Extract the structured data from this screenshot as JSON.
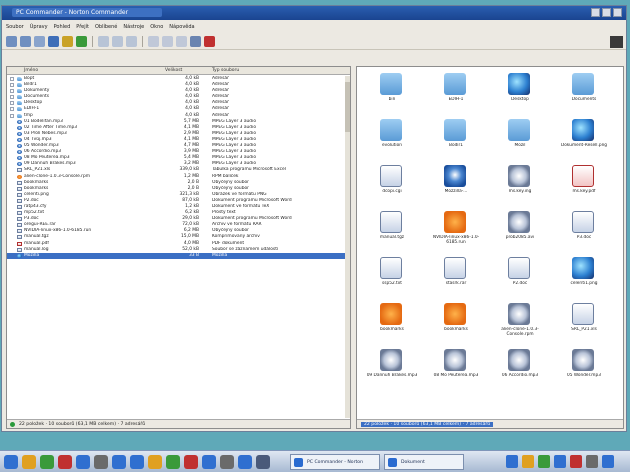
{
  "window": {
    "title": "PC Commander - Norton Commander",
    "menu": [
      "Soubor",
      "Úpravy",
      "Pohled",
      "Přejít",
      "Oblíbené",
      "Nástroje",
      "Okno",
      "Nápověda"
    ]
  },
  "left_pane": {
    "columns": [
      "Jméno",
      "Velikost",
      "Typ souboru"
    ],
    "rows": [
      {
        "name": "Bopt",
        "size": "4,0 kB",
        "type": "Adresář",
        "icon": "folder"
      },
      {
        "name": "Bildr1",
        "size": "4,0 kB",
        "type": "Adresář",
        "icon": "folder"
      },
      {
        "name": "Dokumenty",
        "size": "4,0 kB",
        "type": "Adresář",
        "icon": "folder"
      },
      {
        "name": "Documents",
        "size": "4,0 kB",
        "type": "Adresář",
        "icon": "folder"
      },
      {
        "name": "Desktop",
        "size": "4,0 kB",
        "type": "Adresář",
        "icon": "folder"
      },
      {
        "name": "EDIH-1",
        "size": "4,0 kB",
        "type": "Adresář",
        "icon": "folder"
      },
      {
        "name": "tmp",
        "size": "4,0 kB",
        "type": "Adresář",
        "icon": "folder"
      },
      {
        "name": "01 Bodelifan.mp3",
        "size": "5,7 MB",
        "type": "MPEG Layer 3 audio",
        "icon": "audio"
      },
      {
        "name": "02 Time After Time.mp3",
        "size": "4,1 MB",
        "type": "MPEG Layer 3 audio",
        "icon": "audio"
      },
      {
        "name": "03 Prolí Nebes.mp3",
        "size": "2,9 MB",
        "type": "MPEG Layer 3 audio",
        "icon": "audio"
      },
      {
        "name": "04 Tvůj.mp3",
        "size": "4,1 MB",
        "type": "MPEG Layer 3 audio",
        "icon": "audio"
      },
      {
        "name": "05 Wonder.mp3",
        "size": "4,7 MB",
        "type": "MPEG Layer 3 audio",
        "icon": "audio"
      },
      {
        "name": "06 Accordio.mp3",
        "size": "3,9 MB",
        "type": "MPEG Layer 3 audio",
        "icon": "audio"
      },
      {
        "name": "08 Mo Peuterea.mp3",
        "size": "5,4 MB",
        "type": "MPEG Layer 3 audio",
        "icon": "audio"
      },
      {
        "name": "09 Dannuh Brakes.mp3",
        "size": "3,2 MB",
        "type": "MPEG Layer 3 audio",
        "icon": "audio"
      },
      {
        "name": "SRL_P21.xls",
        "size": "339,0 kB",
        "type": "Tabulka programu Microsoft Excel",
        "icon": "doc"
      },
      {
        "name": "alien-clone-1.0.3-Console.rpm",
        "size": "1,2 MB",
        "type": "RPM balíček",
        "icon": "orange"
      },
      {
        "name": "bookmarks",
        "size": "2,0 B",
        "type": "Obyčejný soubor",
        "icon": "doc"
      },
      {
        "name": "bookmarks",
        "size": "2,0 B",
        "type": "Obyčejný soubor",
        "icon": "doc"
      },
      {
        "name": "celeriti.png",
        "size": "321,3 kB",
        "type": "Obrázek ve formátu PNG",
        "icon": "doc"
      },
      {
        "name": "P2.doc",
        "size": "87,0 kB",
        "type": "Dokument programu Microsoft Word",
        "icon": "doc"
      },
      {
        "name": "ratp43.cfy",
        "size": "1,2 kB",
        "type": "Dokument ve formátu TeX",
        "icon": "doc"
      },
      {
        "name": "mp52.txt",
        "size": "6,2 kB",
        "type": "Prostý text",
        "icon": "doc"
      },
      {
        "name": "P3.doc",
        "size": "29,0 kB",
        "type": "Dokument programu Microsoft Word",
        "icon": "doc"
      },
      {
        "name": "oregui-REE.rar",
        "size": "72,0 kB",
        "type": "Archiv ve formátu RAR",
        "icon": "doc"
      },
      {
        "name": "NVIDIA-linux-x86-1.0-6185.run",
        "size": "6,2 MB",
        "type": "Obyčejný soubor",
        "icon": "doc"
      },
      {
        "name": "manual.tgz",
        "size": "15,0 MB",
        "type": "Komprimovaný archiv",
        "icon": "doc"
      },
      {
        "name": "manual.pdf",
        "size": "4,0 MB",
        "type": "PDF dokument",
        "icon": "pdf"
      },
      {
        "name": "manual.log",
        "size": "52,0 kB",
        "type": "Soubor se záznamem událostí",
        "icon": "doc"
      },
      {
        "name": "Mozilla",
        "size": "33 B",
        "type": "Mozilla",
        "icon": "globe"
      }
    ],
    "status": "22 položek · 10 souborů (63,1 MB celkem) · 7 adresářů"
  },
  "right_pane": {
    "items": [
      {
        "label": "bin",
        "icon": "folder"
      },
      {
        "label": "EDIH-1",
        "icon": "folder"
      },
      {
        "label": "Desktop",
        "icon": "globe"
      },
      {
        "label": "Documents",
        "icon": "folder"
      },
      {
        "label": "evolution",
        "icon": "folder"
      },
      {
        "label": "Bodír1",
        "icon": "folder"
      },
      {
        "label": "Mozil",
        "icon": "folder"
      },
      {
        "label": "Dokument-Resell.png",
        "icon": "globe"
      },
      {
        "label": "dcopi.cgi",
        "icon": "doc"
      },
      {
        "label": "Mozzilla-...",
        "icon": "audio"
      },
      {
        "label": "ms.key.ing",
        "icon": "cd"
      },
      {
        "label": "ms.key.pdf",
        "icon": "pdf"
      },
      {
        "label": "manual.tgz",
        "icon": "doc"
      },
      {
        "label": "NVIDIA-linux-x86-1.0-6185.run",
        "icon": "orange"
      },
      {
        "label": "prob2085.avi",
        "icon": "cd"
      },
      {
        "label": "P3.doc",
        "icon": "doc"
      },
      {
        "label": "ssp52.txt",
        "icon": "doc"
      },
      {
        "label": "stasrk.rar",
        "icon": "doc"
      },
      {
        "label": "P2.doc",
        "icon": "doc"
      },
      {
        "label": "celeriti1.png",
        "icon": "globe"
      },
      {
        "label": "bookmarks",
        "icon": "orange"
      },
      {
        "label": "bookmarks",
        "icon": "orange"
      },
      {
        "label": "alien-clone-1.0.3-Console.rpm",
        "icon": "cd"
      },
      {
        "label": "SRL_P21.xls",
        "icon": "doc"
      },
      {
        "label": "09 Dannuh Brakes.mp3",
        "icon": "cd"
      },
      {
        "label": "08 Mo Peuterea.mp3",
        "icon": "cd"
      },
      {
        "label": "06 Accordio.mp3",
        "icon": "cd"
      },
      {
        "label": "05 Wonder.mp3",
        "icon": "cd"
      }
    ],
    "status": "22 položek · 10 souborů (63,1 MB celkem) · 7 adresářů"
  },
  "taskbar": {
    "task1": "PC Commander - Norton",
    "task2": "Dokument",
    "quick_colors": [
      "#2f6fd0",
      "#e0a020",
      "#3a9a3a",
      "#c03030",
      "#2f6fd0",
      "#6a6a6a",
      "#2f6fd0",
      "#2f6fd0",
      "#e0a020"
    ]
  },
  "colors": {
    "selection": "#3b6fc4",
    "titlebar": "#1a4490",
    "desktop": "#5fa9b8"
  }
}
